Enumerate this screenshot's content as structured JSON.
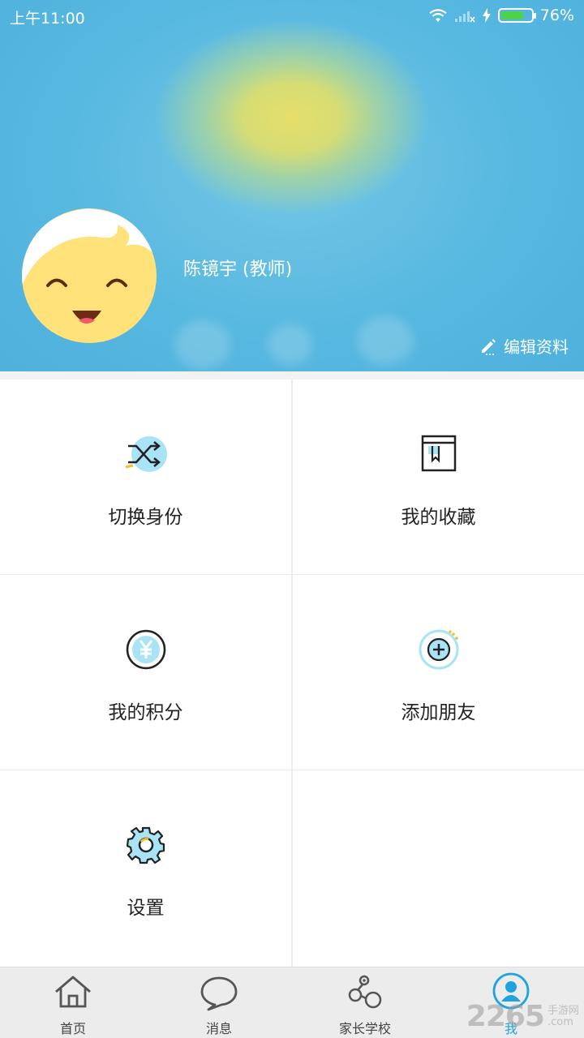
{
  "status_bar": {
    "time": "上午11:00",
    "battery_percent": "76%",
    "battery_level": 0.76
  },
  "profile": {
    "name": "陈镜宇 (教师)",
    "edit_label": "编辑资料"
  },
  "menu": {
    "switch_identity": "切换身份",
    "my_favorites": "我的收藏",
    "my_points": "我的积分",
    "add_friends": "添加朋友",
    "settings": "设置"
  },
  "tabs": {
    "home": "首页",
    "messages": "消息",
    "parent_school": "家长学校",
    "me": "我"
  },
  "watermark": {
    "number": "2265",
    "site": "手游网",
    "domain": ".com"
  },
  "colors": {
    "header_blue": "#52b5df",
    "accent_blue": "#1fa3e0",
    "icon_cyan": "#a8e4f5",
    "battery_green": "#4ed24a"
  }
}
